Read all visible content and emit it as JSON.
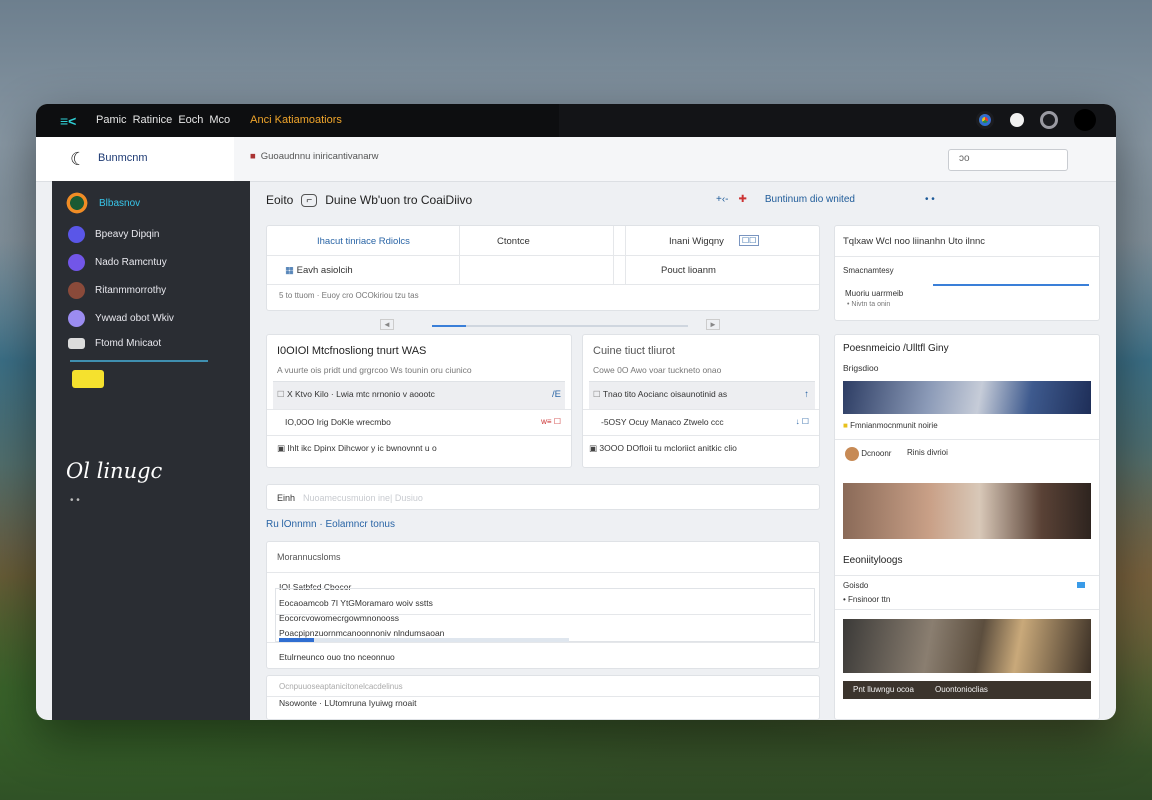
{
  "window": {
    "logo_glyph": "≡<",
    "nav": [
      "Pamic",
      "Ratinice",
      "Eoch",
      "Mco"
    ],
    "nav_accent": "Anci Katiamoatiors",
    "toolbar_icons": [
      "chrome-icon",
      "profile-icon",
      "settings-icon",
      "avatar"
    ]
  },
  "header": {
    "brand": "Bunmcnm",
    "breadcrumb": "Guoaudnnu iniricantivanarw",
    "search_placeholder": "ͻo"
  },
  "sidebar": {
    "items": [
      {
        "label": "Blbasnov",
        "color": "#f08c25",
        "active": true
      },
      {
        "label": "Bpeavy Dipqin",
        "color": "#5a56e8"
      },
      {
        "label": "Nado Ramcntuy",
        "color": "#7256e8"
      },
      {
        "label": "Ritanmmorrothy",
        "color": "#8a4a3a"
      },
      {
        "label": "Ywwad obot Wkiv",
        "color": "#9b8cf0"
      },
      {
        "label": "Ftomd Mnicaot",
        "color": "#dcdcdc"
      }
    ],
    "big_text": "Ol linugc",
    "small_text": "• •"
  },
  "main": {
    "title": "Eoito",
    "title_button": "⌐",
    "title_rest": "Duine Wb'uon tro CoaiDiivo",
    "actions": [
      "+‹-",
      "✚",
      "Buntinum dio wnited",
      "• •"
    ],
    "summary": {
      "col1_head": "Ihacut tinriace Rdiolcs",
      "col2_head": "Ctontce",
      "col3_head": "Inani Wigqny",
      "col3_badge": "☐☐",
      "col1_row": "Eavh asiolcih",
      "col3_row": "Pouct lioanm",
      "foot": "5 to ttuom · Euoy cro OCOkiriou tzu tas"
    },
    "tasks": {
      "title": "I0OIOl Mtcfnosliong tnurt WAS",
      "sub": "A vuurte ois pridt und grgrcoo Ws tounin oru ciunico",
      "rows": [
        {
          "text": "X Ktvo Kilo · Lwia mtc nrnonio v aoootc",
          "flag": "/E",
          "hl": true
        },
        {
          "text": "IO,0OO Irig DoKle wrecmbo",
          "flag": "w≡ ☐",
          "hl": false
        },
        {
          "text": "Ihlt ikc Dpinx Dihcwor y ic bwnovnnt u o",
          "flag": "",
          "hl": false
        }
      ]
    },
    "tasks2": {
      "title": "Cuine tiuct tliurot",
      "sub": "Cowe 0O Awo voar tuckneto onao",
      "rows": [
        {
          "text": "Tnao tito Aocianc oisaunotinid as",
          "flag": "↑",
          "hl": true
        },
        {
          "text": "-5OSY Ocuy Manaco Ztwelo ccc",
          "flag": "↓ ☐",
          "hl": false
        },
        {
          "text": "3OOO DOfIoii tu mcloriict anitkic clio",
          "flag": "",
          "hl": false
        }
      ]
    },
    "filter_label": "Einh",
    "filter_hint": "Nuoamecusmuion ine| Dusiuo",
    "section_link": "Ru lOnnmn · Eolamncr tonus",
    "table": {
      "title": "Morannucsloms",
      "head": "IOI Satbfcd Cbocor",
      "rows": [
        "Eocaoamcob 7I YtGMoramaro woiv sstts",
        "Eocorcvowomecrgowmnonooss",
        "Poacpipnzuornmcanoonnoniv nlndumsaoan"
      ],
      "progress": 0.12,
      "footer": "Etulrneunco ouo tno nceonnuo",
      "sub_head": "Ocnpuuoseaptanicitonelcacdelinus",
      "sub_row": "Nsowonte · LUtomruna Iyuiwg rnoait"
    }
  },
  "right": {
    "card1": {
      "head": "Tqlxaw Wcl noo liinanhn Uto ilnnc",
      "label": "Smacnamtesy",
      "sub_label": "Muoriu uarrmeib",
      "sub_label2": "• Nivtn ta onin",
      "input_value": ""
    },
    "gallery": {
      "title": "Poesnmeicio /Ulltfl Giny",
      "sub": "Brigsdioo",
      "caption1": "Fmnianmocnmunit noirie",
      "person": "Dcnoonr",
      "person_meta": "Rinis divrioi",
      "title2": "Eeoniityloogs",
      "label2": "Goisdo",
      "label3": "• Fnsinoor ttn",
      "bottom_caption": "Pnt lluwngu ocoa",
      "bottom_caption2": "Ouontonioclias"
    }
  }
}
